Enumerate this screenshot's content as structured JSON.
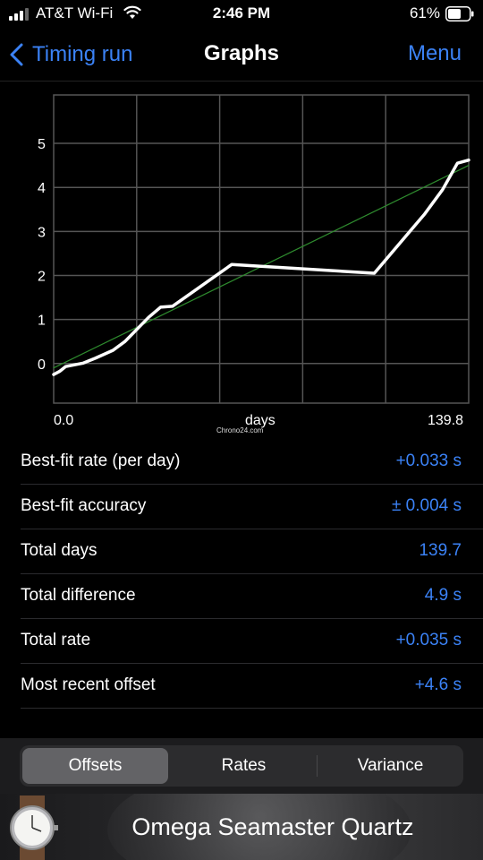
{
  "status_bar": {
    "carrier": "AT&T Wi-Fi",
    "time": "2:46 PM",
    "battery_percent": "61%"
  },
  "nav": {
    "back_label": "Timing run",
    "title": "Graphs",
    "menu_label": "Menu"
  },
  "chart_data": {
    "type": "line",
    "x_axis": {
      "min_label": "0.0",
      "label": "days",
      "max_label": "139.8",
      "range": [
        0,
        139.8
      ]
    },
    "y_axis": {
      "ticks": [
        "0",
        "1",
        "2",
        "3",
        "4",
        "5"
      ],
      "range": [
        -0.9,
        6.1
      ]
    },
    "grid": true,
    "series": [
      {
        "color": "#ffffff",
        "points": [
          [
            0,
            -0.25
          ],
          [
            2,
            -0.18
          ],
          [
            4,
            -0.07
          ],
          [
            10,
            0.01
          ],
          [
            14,
            0.12
          ],
          [
            20,
            0.3
          ],
          [
            24,
            0.5
          ],
          [
            32,
            1.05
          ],
          [
            36,
            1.28
          ],
          [
            40,
            1.3
          ],
          [
            60,
            2.25
          ],
          [
            108,
            2.05
          ],
          [
            125,
            3.4
          ],
          [
            131,
            3.95
          ],
          [
            136,
            4.55
          ],
          [
            139.8,
            4.62
          ]
        ]
      },
      {
        "color": "#2e8b2e",
        "points": [
          [
            0,
            -0.1
          ],
          [
            139.8,
            4.5
          ]
        ]
      }
    ]
  },
  "watermark": "Chrono24.com",
  "stats": [
    {
      "label": "Best-fit rate (per day)",
      "value": "+0.033 s"
    },
    {
      "label": "Best-fit accuracy",
      "value": "± 0.004 s"
    },
    {
      "label": "Total days",
      "value": "139.7"
    },
    {
      "label": "Total difference",
      "value": "4.9 s"
    },
    {
      "label": "Total rate",
      "value": "+0.035 s"
    },
    {
      "label": "Most recent offset",
      "value": "+4.6 s"
    }
  ],
  "segments": [
    {
      "label": "Offsets",
      "selected": true
    },
    {
      "label": "Rates",
      "selected": false
    },
    {
      "label": "Variance",
      "selected": false
    }
  ],
  "banner": {
    "text": "Omega Seamaster Quartz"
  },
  "colors": {
    "accent": "#3b82f6",
    "background": "#000000",
    "fit_line": "#2e8b2e"
  }
}
